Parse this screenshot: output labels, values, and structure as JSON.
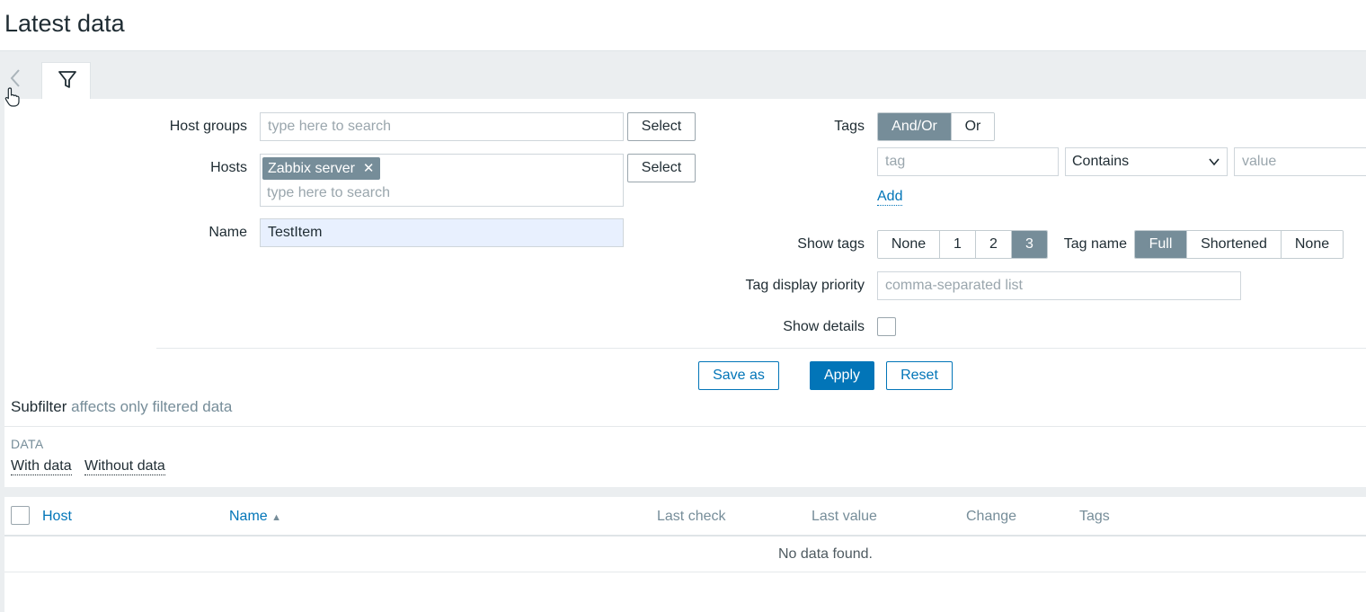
{
  "page": {
    "title": "Latest data"
  },
  "filter": {
    "host_groups": {
      "label": "Host groups",
      "placeholder": "type here to search",
      "select_label": "Select"
    },
    "hosts": {
      "label": "Hosts",
      "chip": "Zabbix server",
      "chip_remove": "✕",
      "placeholder": "type here to search",
      "select_label": "Select"
    },
    "name": {
      "label": "Name",
      "value": "TestItem"
    },
    "tags": {
      "label": "Tags",
      "mode_options": [
        "And/Or",
        "Or"
      ],
      "mode_selected": "And/Or",
      "tag_placeholder": "tag",
      "operator": "Contains",
      "value_placeholder": "value",
      "add_label": "Add"
    },
    "show_tags": {
      "label": "Show tags",
      "options": [
        "None",
        "1",
        "2",
        "3"
      ],
      "selected": "3"
    },
    "tag_name": {
      "label": "Tag name",
      "options": [
        "Full",
        "Shortened",
        "None"
      ],
      "selected": "Full"
    },
    "tag_display_priority": {
      "label": "Tag display priority",
      "placeholder": "comma-separated list"
    },
    "show_details": {
      "label": "Show details",
      "checked": false
    },
    "buttons": {
      "save_as": "Save as",
      "apply": "Apply",
      "reset": "Reset"
    }
  },
  "subfilter": {
    "title": "Subfilter",
    "note": "affects only filtered data",
    "group_title": "DATA",
    "options": [
      "With data",
      "Without data"
    ]
  },
  "table": {
    "columns": [
      "Host",
      "Name",
      "Last check",
      "Last value",
      "Change",
      "Tags"
    ],
    "sort_indicator": "▲",
    "empty_text": "No data found."
  },
  "colors": {
    "accent": "#0275b8",
    "active_segment": "#768d99",
    "background": "#ebeef0"
  }
}
